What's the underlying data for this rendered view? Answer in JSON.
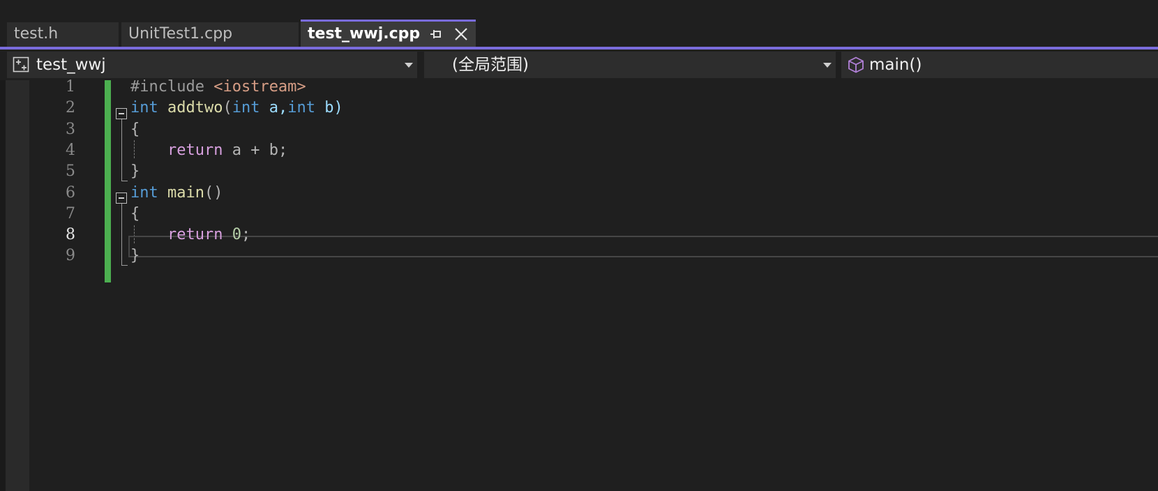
{
  "tabs": [
    {
      "label": "test.h",
      "active": false
    },
    {
      "label": "UnitTest1.cpp",
      "active": false
    },
    {
      "label": "test_wwj.cpp",
      "active": true
    }
  ],
  "navbar": {
    "project": "test_wwj",
    "scope": "(全局范围)",
    "member": "main()"
  },
  "editor": {
    "current_line": 8,
    "lines": [
      {
        "no": "1",
        "tokens": [
          {
            "t": "#include ",
            "c": "#9b9b9b"
          },
          {
            "t": "<iostream>",
            "c": "#d69d85"
          }
        ]
      },
      {
        "no": "2",
        "tokens": [
          {
            "t": "int",
            "c": "#569cd6"
          },
          {
            "t": " ",
            "c": "#d4d4d4"
          },
          {
            "t": "addtwo",
            "c": "#dcdcaa"
          },
          {
            "t": "(",
            "c": "#b4b4b4"
          },
          {
            "t": "int",
            "c": "#569cd6"
          },
          {
            "t": " a,",
            "c": "#9cdcfe"
          },
          {
            "t": "int",
            "c": "#569cd6"
          },
          {
            "t": " b)",
            "c": "#9cdcfe"
          }
        ]
      },
      {
        "no": "3",
        "tokens": [
          {
            "t": "{",
            "c": "#b4b4b4"
          }
        ]
      },
      {
        "no": "4",
        "tokens": [
          {
            "t": "    ",
            "c": "#d4d4d4"
          },
          {
            "t": "return",
            "c": "#d8a0df"
          },
          {
            "t": " a + b;",
            "c": "#b4b4b4"
          }
        ]
      },
      {
        "no": "5",
        "tokens": [
          {
            "t": "}",
            "c": "#b4b4b4"
          }
        ]
      },
      {
        "no": "6",
        "tokens": [
          {
            "t": "int",
            "c": "#569cd6"
          },
          {
            "t": " ",
            "c": "#d4d4d4"
          },
          {
            "t": "main",
            "c": "#dcdcaa"
          },
          {
            "t": "()",
            "c": "#b4b4b4"
          }
        ]
      },
      {
        "no": "7",
        "tokens": [
          {
            "t": "{",
            "c": "#b4b4b4"
          }
        ]
      },
      {
        "no": "8",
        "tokens": [
          {
            "t": "    ",
            "c": "#d4d4d4"
          },
          {
            "t": "return",
            "c": "#d8a0df"
          },
          {
            "t": " ",
            "c": "#d4d4d4"
          },
          {
            "t": "0",
            "c": "#b5cea8"
          },
          {
            "t": ";",
            "c": "#b4b4b4"
          }
        ]
      },
      {
        "no": "9",
        "tokens": [
          {
            "t": "}",
            "c": "#b4b4b4"
          }
        ]
      }
    ]
  },
  "colors": {
    "accent": "#7a6cdc",
    "change_bar": "#4caf50",
    "member_icon": "#b180d7"
  }
}
